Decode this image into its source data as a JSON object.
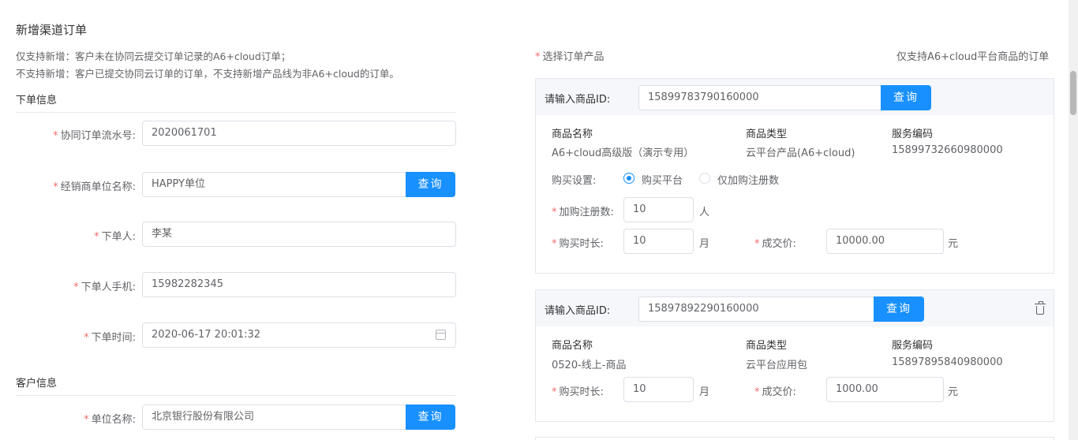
{
  "page": {
    "title": "新增渠道订单",
    "note_support": "仅支持新增：客户未在协同云提交订单记录的A6+cloud订单；",
    "note_unsupport": "不支持新增：客户已提交协同云订单的订单，不支持新增产品线为非A6+cloud的订单。"
  },
  "order_info": {
    "section_title": "下单信息",
    "serial_label": "协同订单流水号:",
    "serial_value": "2020061701",
    "dealer_label": "经销商单位名称:",
    "dealer_value": "HAPPY单位",
    "dealer_query": "查询",
    "orderer_label": "下单人:",
    "orderer_value": "李某",
    "phone_label": "下单人手机:",
    "phone_value": "15982282345",
    "time_label": "下单时间:",
    "time_value": "2020-06-17 20:01:32"
  },
  "customer_info": {
    "section_title": "客户信息",
    "company_label": "单位名称:",
    "company_value": "北京银行股份有限公司",
    "company_query": "查询"
  },
  "products": {
    "select_label": "选择订单产品",
    "hint": "仅支持A6+cloud平台商品的订单",
    "id_label": "请输入商品ID:",
    "query_label": "查询",
    "col_name": "商品名称",
    "col_type": "商品类型",
    "col_code": "服务编码",
    "duration_label": "购买时长:",
    "price_label": "成交价:",
    "unit_month": "月",
    "unit_yuan": "元",
    "items": [
      {
        "id": "15899783790160000",
        "name": "A6+cloud高级版（演示专用）",
        "type": "云平台产品(A6+cloud)",
        "code": "15899732660980000",
        "purchase_label": "购买设置:",
        "option_platform": "购买平台",
        "option_register": "仅加购注册数",
        "selected_option": "购买平台",
        "register_label": "加购注册数:",
        "register_value": "10",
        "register_unit": "人",
        "duration_value": "10",
        "price_value": "10000.00"
      },
      {
        "id": "15897892290160000",
        "name": "0520-线上-商品",
        "type": "云平台应用包",
        "code": "15897895840980000",
        "duration_value": "10",
        "price_value": "1000.00"
      }
    ]
  },
  "icons": {
    "calendar": "calendar-icon",
    "delete": "trash-icon"
  },
  "colors": {
    "primary": "#1890ff",
    "required": "#f56c6c"
  }
}
